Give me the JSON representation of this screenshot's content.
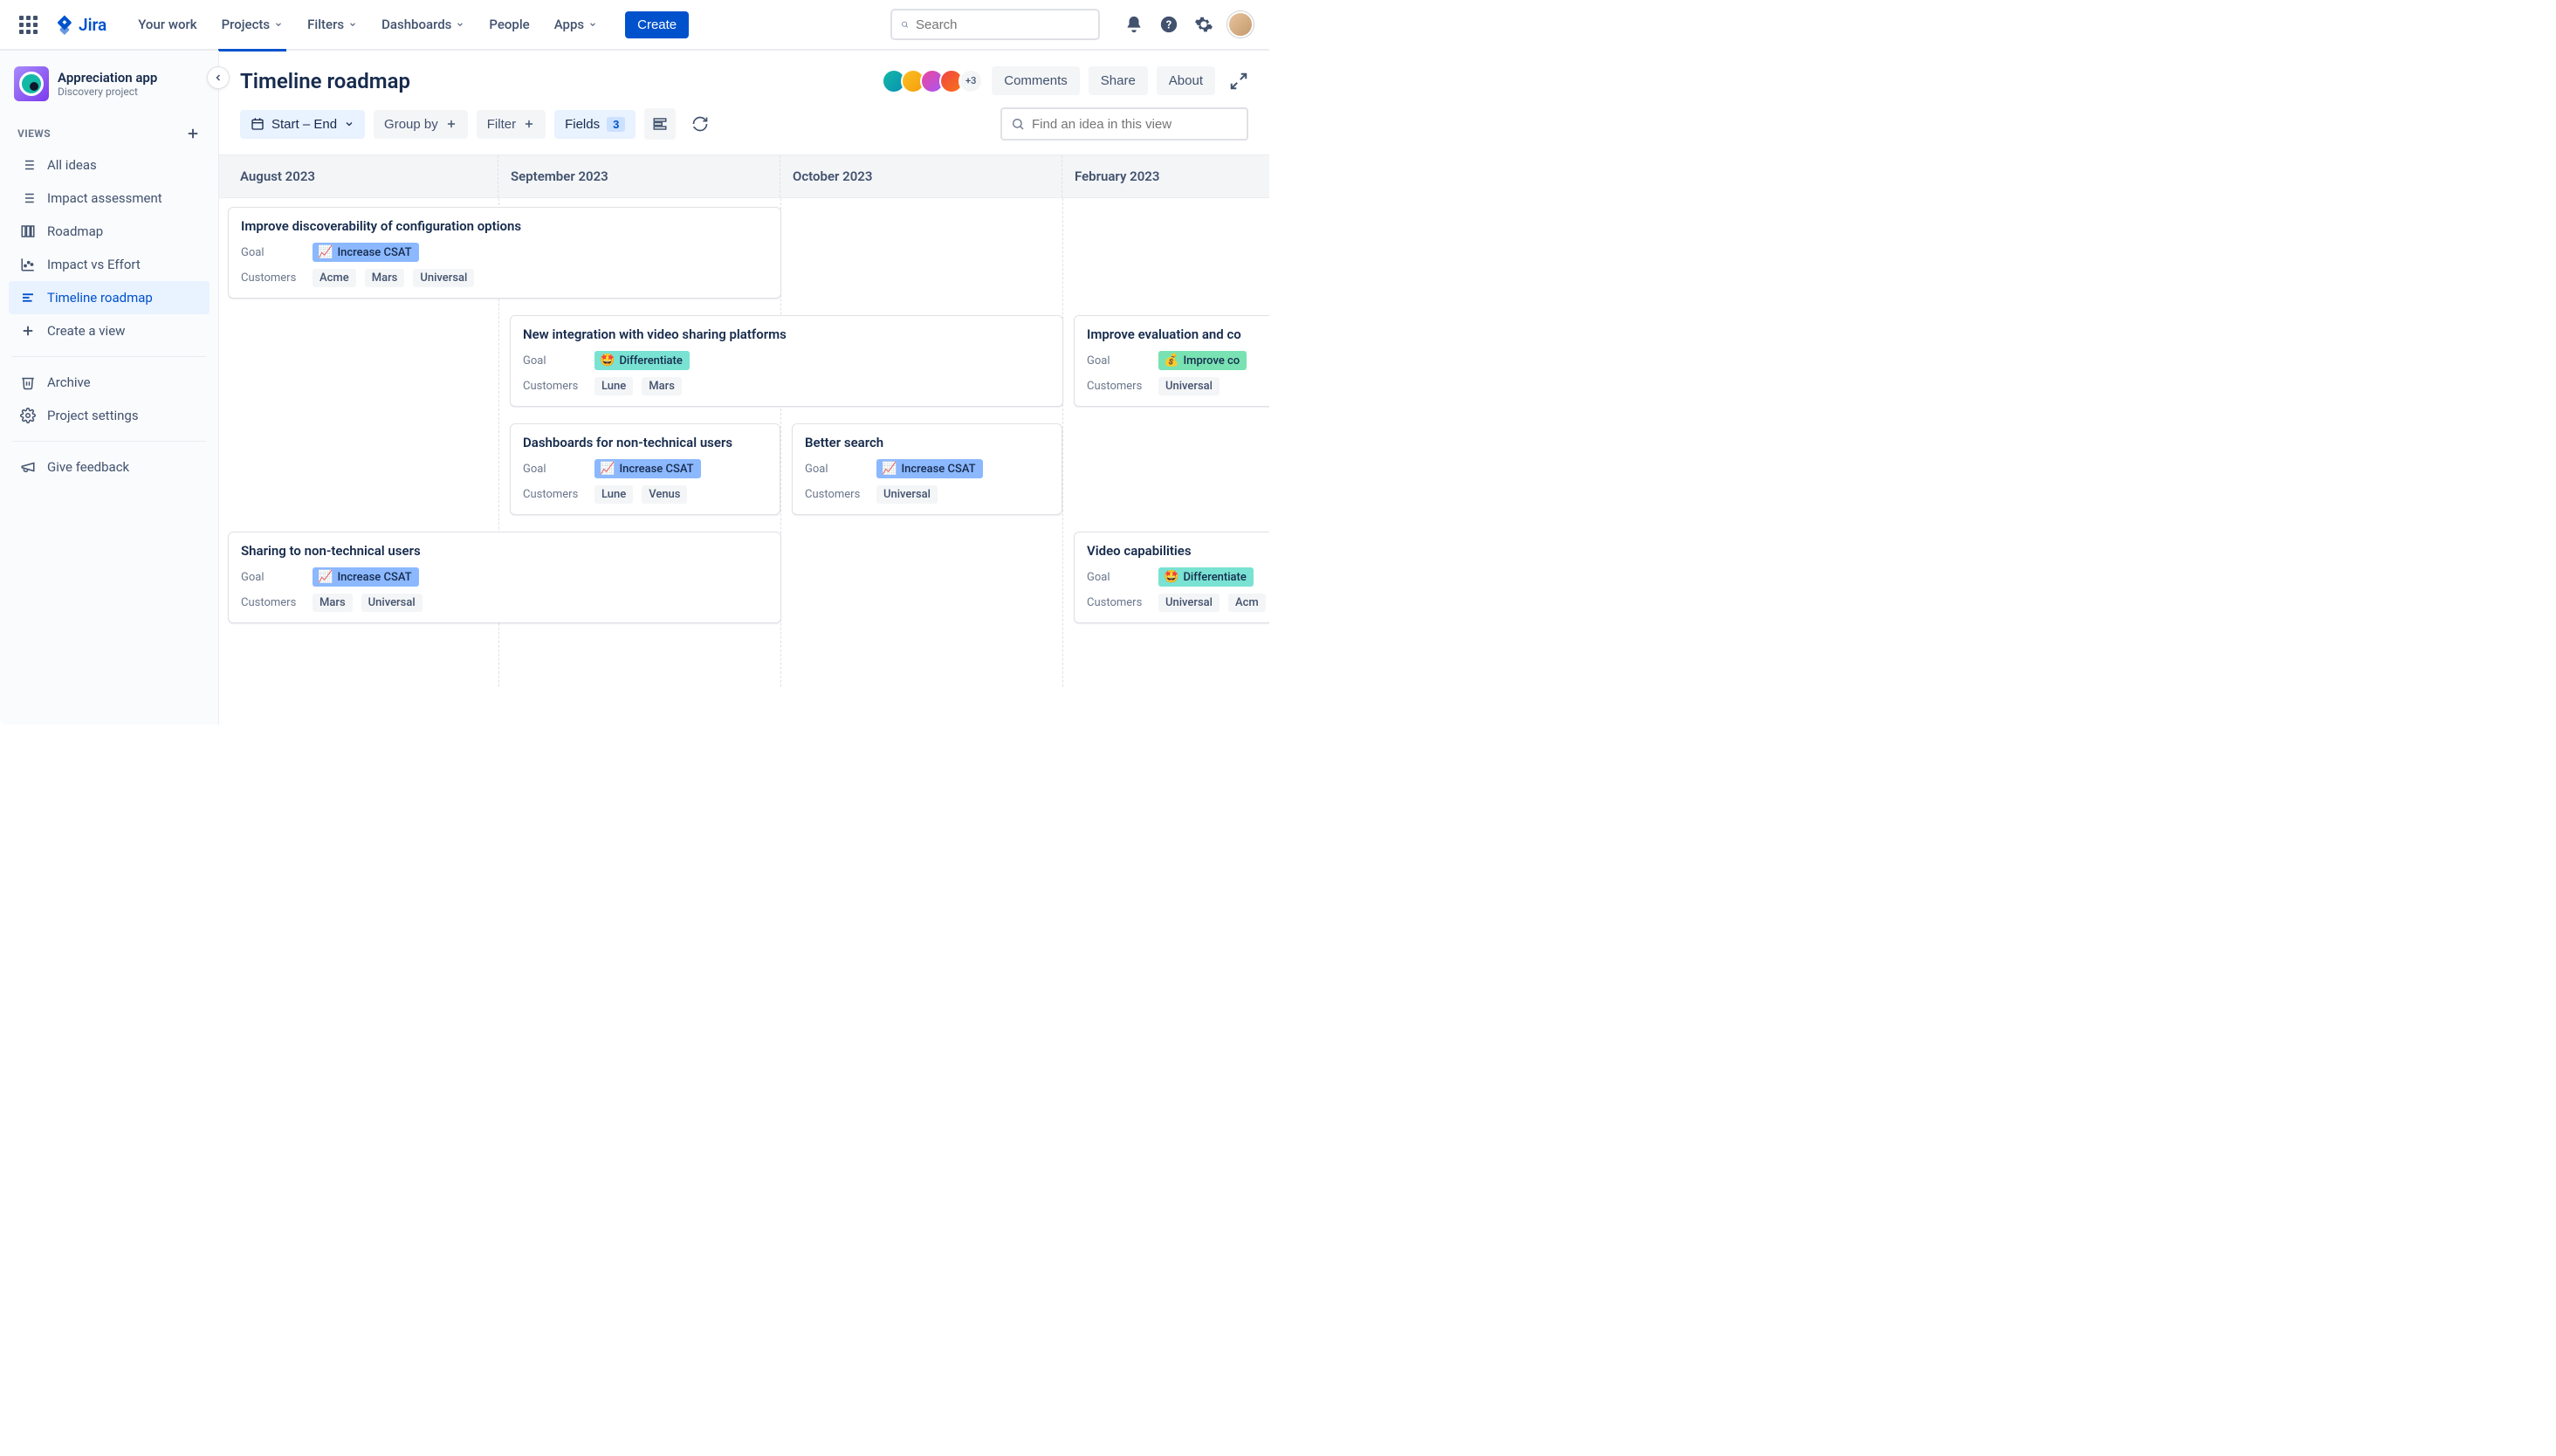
{
  "topnav": {
    "product": "Jira",
    "items": [
      "Your work",
      "Projects",
      "Filters",
      "Dashboards",
      "People",
      "Apps"
    ],
    "dropdown_items": [
      1,
      2,
      3,
      5
    ],
    "active_index": 1,
    "create": "Create",
    "search_placeholder": "Search"
  },
  "sidebar": {
    "project_name": "Appreciation app",
    "project_subtitle": "Discovery project",
    "section": "VIEWS",
    "items": [
      {
        "icon": "list",
        "label": "All ideas"
      },
      {
        "icon": "list",
        "label": "Impact assessment"
      },
      {
        "icon": "board",
        "label": "Roadmap"
      },
      {
        "icon": "chart",
        "label": "Impact vs Effort"
      },
      {
        "icon": "timeline",
        "label": "Timeline roadmap",
        "active": true
      },
      {
        "icon": "plus",
        "label": "Create a view"
      }
    ],
    "archive": "Archive",
    "settings": "Project settings",
    "feedback": "Give feedback"
  },
  "header": {
    "title": "Timeline roadmap",
    "avatar_more": "+3",
    "buttons": [
      "Comments",
      "Share",
      "About"
    ]
  },
  "toolbar": {
    "start_end": "Start – End",
    "group_by": "Group by",
    "filter": "Filter",
    "fields": "Fields",
    "fields_count": "3",
    "find_placeholder": "Find an idea in this view"
  },
  "timeline": {
    "months": [
      "August 2023",
      "September 2023",
      "October 2023",
      "February 2023"
    ],
    "labels": {
      "goal": "Goal",
      "customers": "Customers"
    },
    "goals": {
      "csat": {
        "emoji": "📈",
        "label": "Increase CSAT"
      },
      "diff": {
        "emoji": "🤩",
        "label": "Differentiate"
      },
      "conv": {
        "emoji": "💰",
        "label": "Improve co"
      }
    },
    "cards": {
      "r1c1": {
        "title": "Improve discoverability of configuration options",
        "goal": "csat",
        "customers": [
          "Acme",
          "Mars",
          "Universal"
        ]
      },
      "r2c1": {
        "title": "New integration with video sharing platforms",
        "goal": "diff",
        "customers": [
          "Lune",
          "Mars"
        ]
      },
      "r2c2": {
        "title": "Improve evaluation and co",
        "goal": "conv",
        "customers": [
          "Universal"
        ]
      },
      "r3c1": {
        "title": "Dashboards for non-technical users",
        "goal": "csat",
        "customers": [
          "Lune",
          "Venus"
        ]
      },
      "r3c2": {
        "title": "Better search",
        "goal": "csat",
        "customers": [
          "Universal"
        ]
      },
      "r4c1": {
        "title": "Sharing to non-technical users",
        "goal": "csat",
        "customers": [
          "Mars",
          "Universal"
        ]
      },
      "r4c2": {
        "title": "Video capabilities",
        "goal": "diff",
        "customers": [
          "Universal",
          "Acm"
        ]
      }
    }
  }
}
